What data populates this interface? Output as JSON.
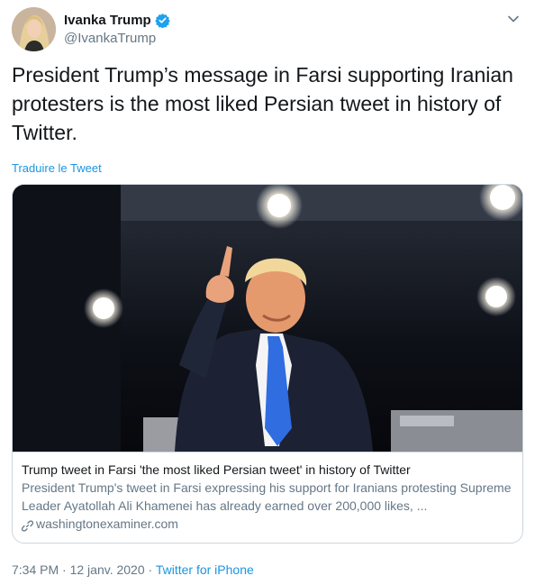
{
  "user": {
    "display_name": "Ivanka Trump",
    "handle": "@IvankaTrump",
    "verified_icon": "verified-badge-icon",
    "verified_color": "#1da1f2"
  },
  "tweet": {
    "text": "President Trump’s message in Farsi supporting Iranian protesters is the most liked Persian tweet in history of Twitter.",
    "translate_label": "Traduire le Tweet"
  },
  "card": {
    "title": "Trump tweet in Farsi 'the most liked Persian tweet' in history of Twitter",
    "description": "President Trump's tweet in Farsi expressing his support for Iranians protesting Supreme Leader Ayatollah Ali Khamenei has already earned over 200,000 likes, ...",
    "domain": "washingtonexaminer.com",
    "domain_icon": "link-icon"
  },
  "meta": {
    "time": "7:34 PM",
    "separator1": " · ",
    "date": "12 janv. 2020",
    "separator2": " · ",
    "source": "Twitter for iPhone"
  },
  "colors": {
    "link": "#1b95e0",
    "secondary_text": "#657786",
    "border": "#ccd6dd"
  }
}
